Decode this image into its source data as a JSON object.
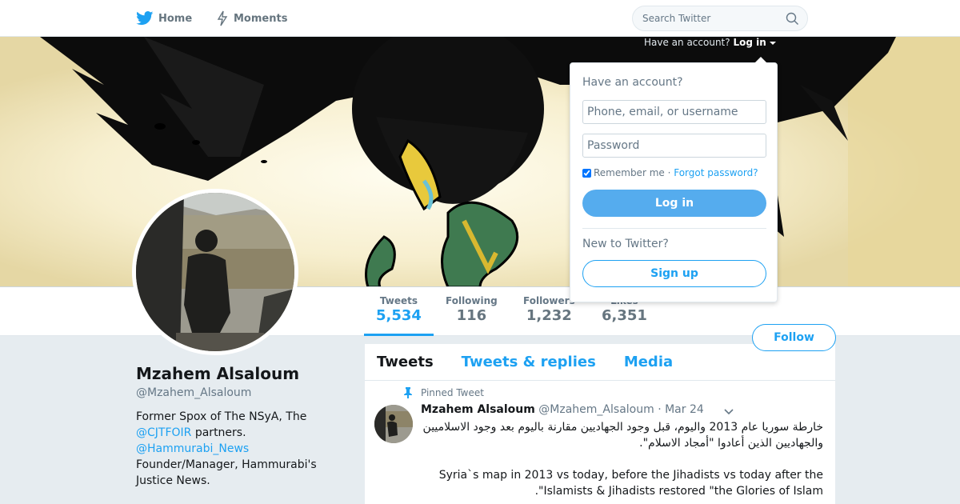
{
  "nav": {
    "home_label": "Home",
    "moments_label": "Moments",
    "search_placeholder": "Search Twitter"
  },
  "login_hint": {
    "text": "Have an account?",
    "action": "Log in"
  },
  "login_box": {
    "title": "Have an account?",
    "username_placeholder": "Phone, email, or username",
    "password_placeholder": "Password",
    "remember_label": "Remember me",
    "separator": " · ",
    "forgot_label": "Forgot password?",
    "login_button": "Log in",
    "new_title": "New to Twitter?",
    "signup_button": "Sign up"
  },
  "stats": [
    {
      "label": "Tweets",
      "value": "5,534"
    },
    {
      "label": "Following",
      "value": "116"
    },
    {
      "label": "Followers",
      "value": "1,232"
    },
    {
      "label": "Likes",
      "value": "6,351"
    }
  ],
  "follow_label": "Follow",
  "profile": {
    "name": "Mzahem Alsaloum",
    "handle": "@Mzahem_Alsaloum",
    "bio_1": "Former Spox of The NSyA, The",
    "bio_link_1": "@CJTFOIR",
    "bio_2": " partners.",
    "bio_link_2": "@Hammurabi_News",
    "bio_3": "Founder/Manager, Hammurabi's Justice News."
  },
  "tabs": [
    "Tweets",
    "Tweets & replies",
    "Media"
  ],
  "tweet": {
    "pinned_label": "Pinned Tweet",
    "name": "Mzahem Alsaloum",
    "handle": "@Mzahem_Alsaloum",
    "date": "· Mar 24",
    "text_ar_1": "خارطة سوريا عام 2013 واليوم، قبل وجود الجهاديين مقارنة باليوم بعد وجود الاسلاميين",
    "text_ar_2": "والجهاديين الذين أعادوا \"أمجاد الاسلام\".",
    "text_en_1": "Syria`s map in 2013 vs today, before the Jihadists vs today after the",
    "text_en_2": ".\"Islamists & Jihadists restored \"the Glories of Islam"
  },
  "colors": {
    "accent": "#1da1f2",
    "login_button": "#55acee",
    "background": "#e6ecf0"
  }
}
